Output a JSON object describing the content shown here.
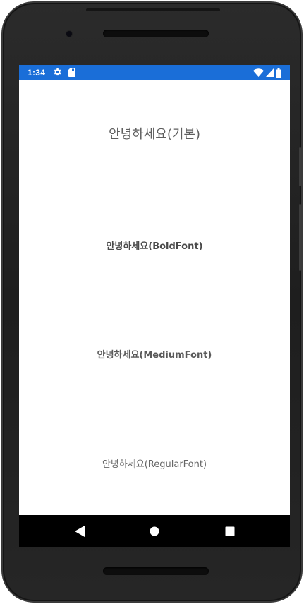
{
  "status_bar": {
    "time": "1:34",
    "background_color": "#1a6ed8",
    "left_icons": [
      "gear-icon",
      "sd-card-icon"
    ],
    "right_icons": [
      "wifi-icon",
      "cell-signal-icon",
      "battery-icon"
    ]
  },
  "content": {
    "labels": {
      "default": "안녕하세요(기본)",
      "bold": "안녕하세요(BoldFont)",
      "medium": "안녕하세요(MediumFont)",
      "regular": "안녕하세요(RegularFont)"
    }
  },
  "navigation_bar": {
    "buttons": [
      "back-icon",
      "home-icon",
      "recents-icon"
    ]
  }
}
